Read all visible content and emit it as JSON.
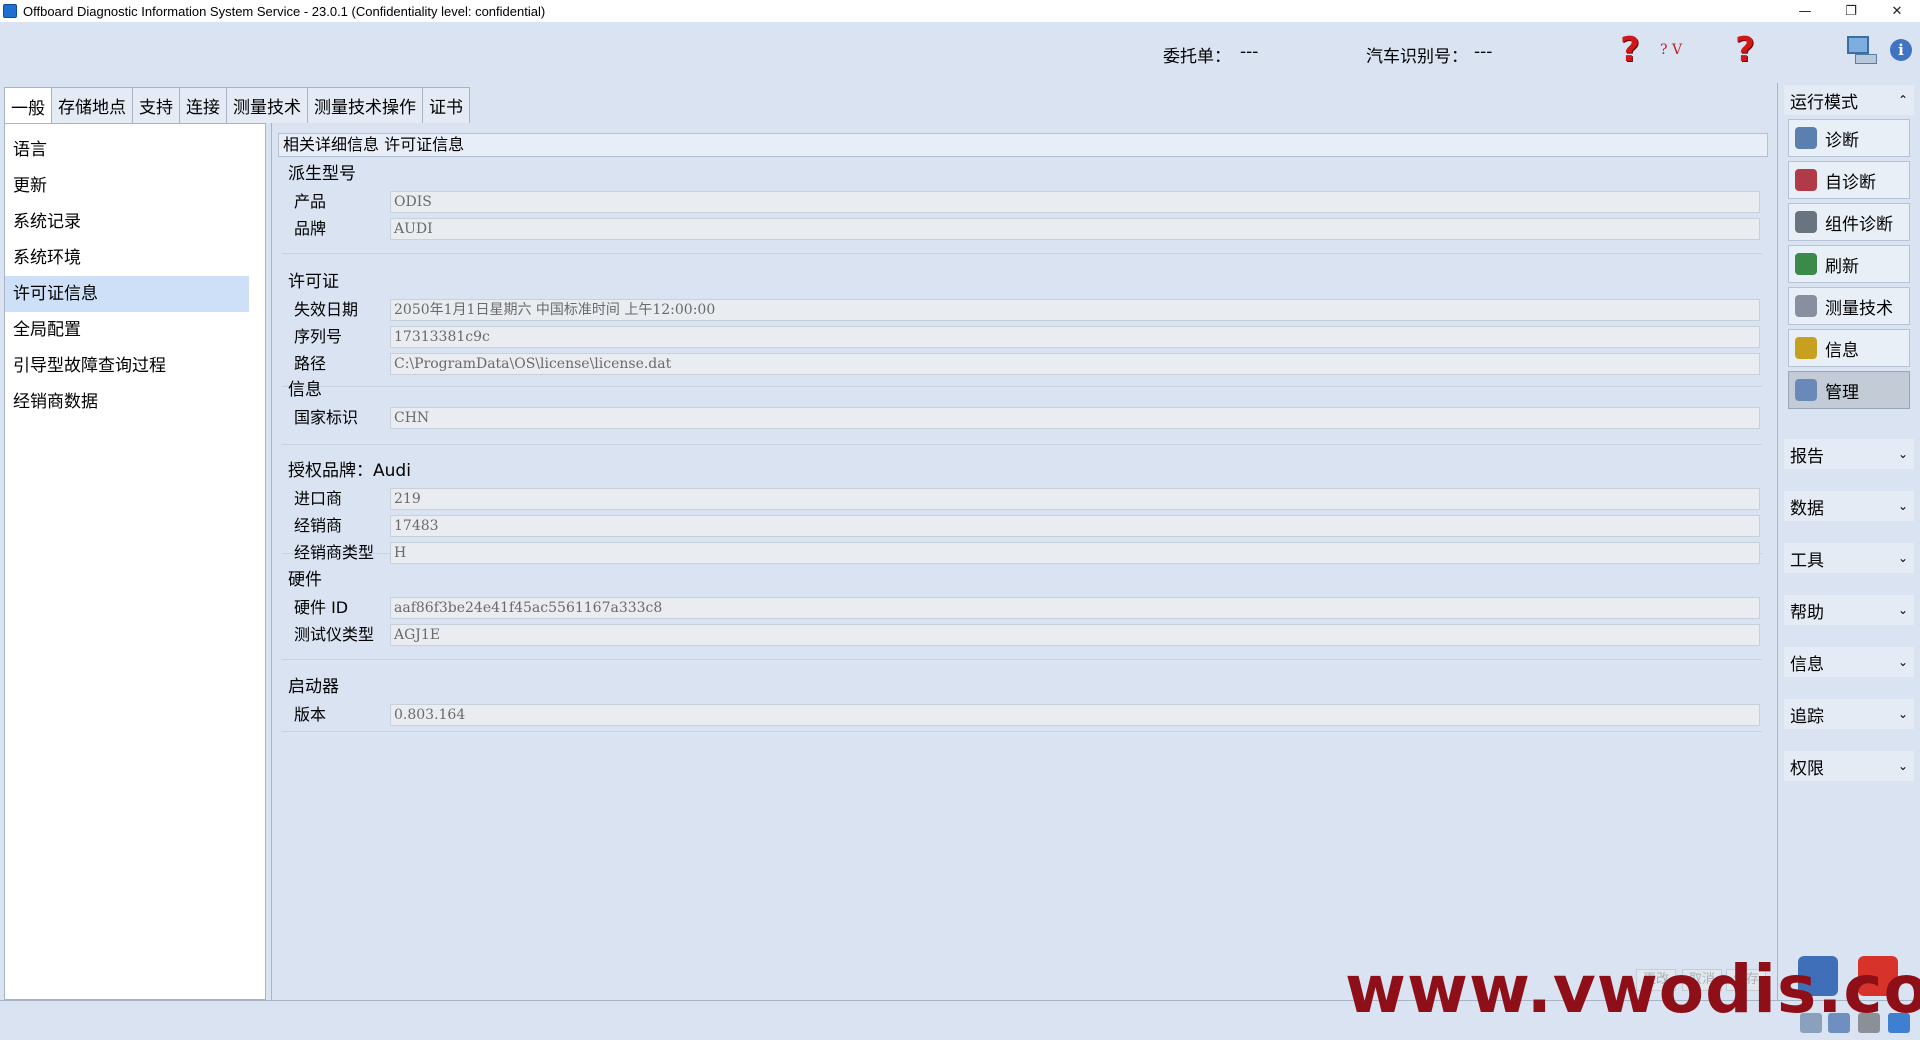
{
  "window": {
    "title": "Offboard Diagnostic Information System Service - 23.0.1 (Confidentiality level: confidential)",
    "minimize": "—",
    "restore": "❐",
    "close": "✕"
  },
  "header": {
    "order_label": "委托单：",
    "order_value": "---",
    "vin_label": "汽车识别号：",
    "vin_value": "---",
    "help_v": "? V"
  },
  "tabs": [
    "一般",
    "存储地点",
    "支持",
    "连接",
    "测量技术",
    "测量技术操作",
    "证书"
  ],
  "nav": {
    "items": [
      "语言",
      "更新",
      "系统记录",
      "系统环境",
      "许可证信息",
      "全局配置",
      "引导型故障查询过程",
      "经销商数据"
    ],
    "selected_index": 4
  },
  "content": {
    "header": "相关详细信息 许可证信息",
    "groups": [
      {
        "title": "派生型号",
        "fields": [
          {
            "label": "产品",
            "value": "ODIS"
          },
          {
            "label": "品牌",
            "value": "AUDI"
          }
        ]
      },
      {
        "title": "许可证",
        "fields": [
          {
            "label": "失效日期",
            "value": "2050年1月1日星期六 中国标准时间 上午12:00:00"
          },
          {
            "label": "序列号",
            "value": "17313381c9c"
          },
          {
            "label": "路径",
            "value": "C:\\ProgramData\\OS\\license\\license.dat"
          }
        ]
      },
      {
        "title": "信息",
        "fields": [
          {
            "label": "国家标识",
            "value": "CHN"
          }
        ]
      },
      {
        "title": "授权品牌：Audi",
        "fields": [
          {
            "label": "进口商",
            "value": "219"
          },
          {
            "label": "经销商",
            "value": "17483"
          },
          {
            "label": "经销商类型",
            "value": "H"
          }
        ]
      },
      {
        "title": "硬件",
        "fields": [
          {
            "label": "硬件 ID",
            "value": "aaf86f3be24e41f45ac5561167a333c8"
          },
          {
            "label": "测试仪类型",
            "value": "AGJ1E"
          }
        ]
      },
      {
        "title": "启动器",
        "fields": [
          {
            "label": "版本",
            "value": "0.803.164"
          }
        ]
      }
    ]
  },
  "right_panel": {
    "mode_title": "运行模式",
    "mode_buttons": [
      {
        "label": "诊断",
        "color": "#5b7fb0"
      },
      {
        "label": "自诊断",
        "color": "#b03a48"
      },
      {
        "label": "组件诊断",
        "color": "#6a7480"
      },
      {
        "label": "刷新",
        "color": "#3a8a4a"
      },
      {
        "label": "测量技术",
        "color": "#8890a0"
      },
      {
        "label": "信息",
        "color": "#c8a020"
      },
      {
        "label": "管理",
        "color": "#6a88b8"
      }
    ],
    "active_mode_index": 6,
    "sections": [
      "报告",
      "数据",
      "工具",
      "帮助",
      "信息",
      "追踪",
      "权限"
    ]
  },
  "bottom": {
    "ghost_buttons": [
      "更改",
      "取消",
      "保存"
    ],
    "watermark": "www.vwodis.com"
  },
  "colors": {
    "background": "#d9e3f1",
    "selected_nav": "#cde0f7",
    "watermark": "#8e0f17",
    "help_red": "#d01818"
  }
}
